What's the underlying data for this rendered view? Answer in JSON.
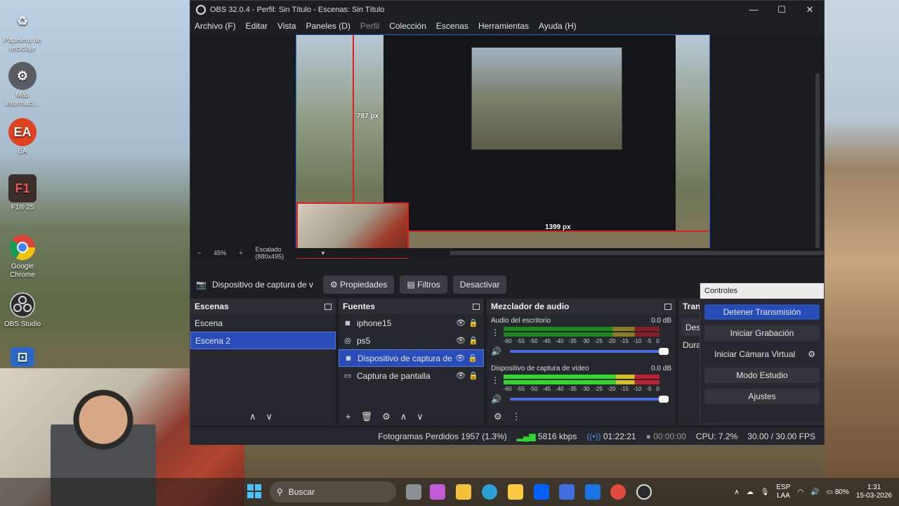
{
  "desktop": {
    "icons": [
      {
        "label": "Papelera de reciclaje",
        "icon": "recycle-bin-icon",
        "glyph": "♻",
        "color": "#dfe8f0"
      },
      {
        "label": "Más informaci...",
        "icon": "info-icon",
        "glyph": "⚙",
        "color": "#5a5e63"
      },
      {
        "label": "EA",
        "icon": "ea-icon",
        "glyph": "EA",
        "color": "#e2421d"
      },
      {
        "label": "F1® 25",
        "icon": "f1-game-icon",
        "glyph": "F1",
        "color": "#3a2e2a"
      },
      {
        "label": "Google Chrome",
        "icon": "chrome-icon",
        "glyph": "●",
        "color": "#e8e8e8"
      },
      {
        "label": "OBS Studio",
        "icon": "obs-icon",
        "glyph": "◉",
        "color": "#2d2d30"
      },
      {
        "label": "",
        "icon": "gamepad-icon",
        "glyph": "🎮",
        "color": "#2867c8"
      }
    ]
  },
  "obs": {
    "title": "OBS 32.0.4 - Perfil: Sin Título - Escenas: Sin Título",
    "window_buttons": [
      "—",
      "☐",
      "✕"
    ],
    "menu": [
      "Archivo (F)",
      "Editar",
      "Vista",
      "Paneles (D)",
      "Perfil",
      "Colección",
      "Escenas",
      "Herramientas",
      "Ayuda (H)"
    ],
    "preview": {
      "label_top": "787 px",
      "label_bottom": "1399 px",
      "zoom": "45%",
      "scale_label": "Escalado (880x495)"
    },
    "source_toolbar": {
      "name": "Dispositivo de captura de v",
      "properties": "Propiedades",
      "filters": "Filtros",
      "deactivate": "Desactivar"
    },
    "scenes": {
      "title": "Escenas",
      "items": [
        {
          "label": "Escena",
          "selected": false
        },
        {
          "label": "Escena 2",
          "selected": true
        }
      ]
    },
    "sources": {
      "title": "Fuentes",
      "items": [
        {
          "label": "iphone15",
          "icon": "camera-icon",
          "glyph": "📷",
          "selected": false
        },
        {
          "label": "ps5",
          "icon": "gamepad-icon",
          "glyph": "🎮",
          "selected": false
        },
        {
          "label": "Dispositivo de captura de",
          "icon": "camera-icon",
          "glyph": "📷",
          "selected": true
        },
        {
          "label": "Captura de pantalla",
          "icon": "monitor-icon",
          "glyph": "▭",
          "selected": false
        }
      ]
    },
    "mixer": {
      "title": "Mezclador de audio",
      "channels": [
        {
          "name": "Audio del escritorio",
          "db": "0.0 dB",
          "hot": false
        },
        {
          "name": "Dispositivo de captura de vídeo",
          "db": "0.0 dB",
          "hot": true
        }
      ],
      "scale": [
        "-60",
        "-55",
        "-50",
        "-45",
        "-40",
        "-35",
        "-30",
        "-25",
        "-20",
        "-15",
        "-10",
        "-5",
        "0"
      ]
    },
    "transitions": {
      "title": "Tran",
      "item1": "Des",
      "item2": "Dura"
    },
    "controls": {
      "title": "Controles",
      "buttons": [
        "Detener Transmisión",
        "Iniciar Grabación",
        "Iniciar Cámara Virtual",
        "Modo Estudio",
        "Ajustes"
      ]
    },
    "status": {
      "dropped": "Fotogramas Perdidos 1957 (1.3%)",
      "bitrate": "5816 kbps",
      "stream_time": "01:22:21",
      "rec_time": "00:00:00",
      "cpu": "CPU: 7.2%",
      "fps": "30.00 / 30.00 FPS"
    }
  },
  "taskbar": {
    "search": "Buscar",
    "lang_1": "ESP",
    "lang_2": "LAA",
    "battery": "80%",
    "time": "1:31",
    "date": "15-03-2026",
    "apps": [
      {
        "icon": "widgets-icon",
        "color": "#8a8f95"
      },
      {
        "icon": "copilot-icon",
        "color": "#c35ad8"
      },
      {
        "icon": "file-explorer-icon",
        "color": "#f2c13b"
      },
      {
        "icon": "edge-icon",
        "color": "#2aa1d8"
      },
      {
        "icon": "store-icon",
        "color": "#ffc83d"
      },
      {
        "icon": "dropbox-icon",
        "color": "#0061fe"
      },
      {
        "icon": "notes-icon",
        "color": "#3d6fe0"
      },
      {
        "icon": "outlook-icon",
        "color": "#1a73e8"
      },
      {
        "icon": "chrome-icon",
        "color": "#e04a3a"
      },
      {
        "icon": "obs-icon",
        "color": "#2b2b2e"
      }
    ]
  }
}
